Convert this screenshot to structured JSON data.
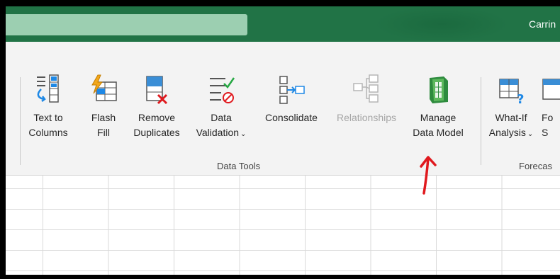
{
  "titlebar": {
    "user_name": "Carrin",
    "colors": {
      "bar": "#217346",
      "search": "#9ccfb1"
    }
  },
  "ribbon": {
    "buttons": [
      {
        "label_line1": "Text to",
        "label_line2": "Columns",
        "icon": "text-to-columns-icon"
      },
      {
        "label_line1": "Flash",
        "label_line2": "Fill",
        "icon": "flash-fill-icon"
      },
      {
        "label_line1": "Remove",
        "label_line2": "Duplicates",
        "icon": "remove-duplicates-icon"
      },
      {
        "label_line1": "Data",
        "label_line2": "Validation",
        "icon": "data-validation-icon",
        "dropdown": "⌄"
      },
      {
        "label_line1": "Consolidate",
        "icon": "consolidate-icon"
      },
      {
        "label_line1": "Relationships",
        "icon": "relationships-icon",
        "disabled": true
      },
      {
        "label_line1": "Manage",
        "label_line2": "Data Model",
        "icon": "manage-data-model-icon"
      },
      {
        "label_line1": "What-If",
        "label_line2": "Analysis",
        "icon": "what-if-analysis-icon",
        "dropdown": "⌄"
      },
      {
        "label_line1": "Fo",
        "label_line2": "S",
        "icon": "forecast-sheet-icon"
      }
    ],
    "groups": {
      "data_tools": "Data Tools",
      "forecast": "Forecas"
    }
  },
  "annotation": {
    "color": "#e0191e"
  }
}
